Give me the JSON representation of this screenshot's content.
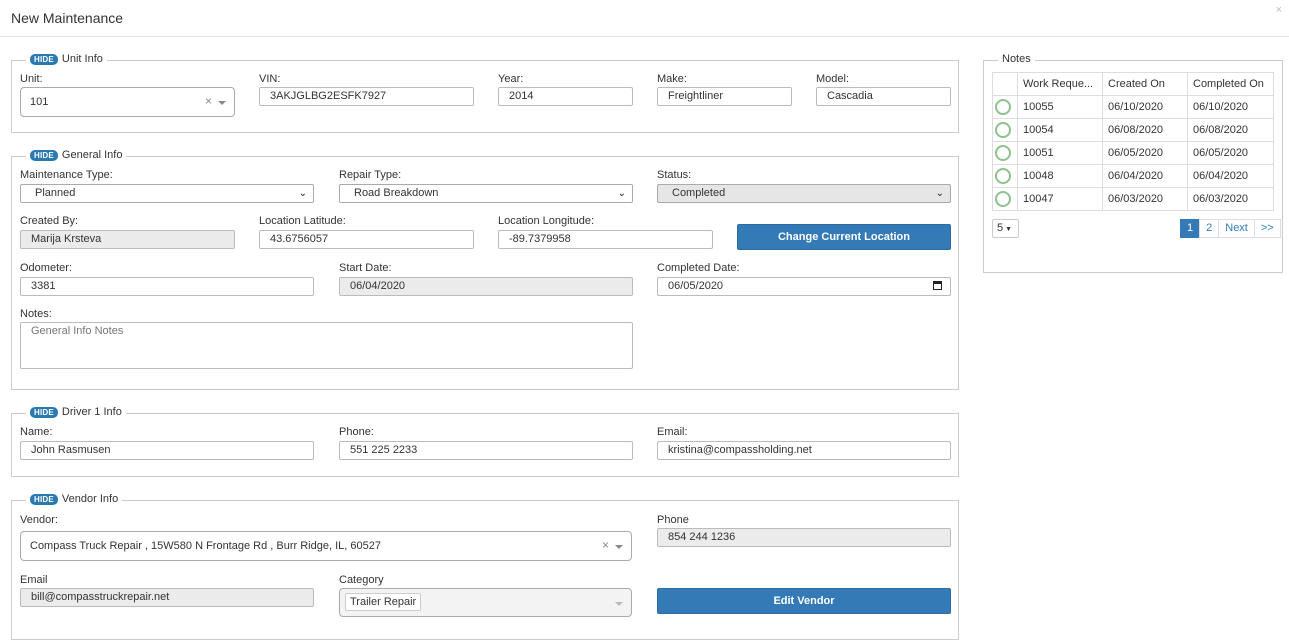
{
  "modal": {
    "title": "New Maintenance",
    "close": "×"
  },
  "unit_info": {
    "hide": "HIDE",
    "title": "Unit Info",
    "unit_label": "Unit:",
    "unit_value": "101",
    "vin_label": "VIN:",
    "vin_value": "3AKJGLBG2ESFK7927",
    "year_label": "Year:",
    "year_value": "2014",
    "make_label": "Make:",
    "make_value": "Freightliner",
    "model_label": "Model:",
    "model_value": "Cascadia"
  },
  "general_info": {
    "hide": "HIDE",
    "title": "General Info",
    "maint_type_label": "Maintenance Type:",
    "maint_type_value": "Planned",
    "repair_type_label": "Repair Type:",
    "repair_type_value": "Road Breakdown",
    "status_label": "Status:",
    "status_value": "Completed",
    "created_by_label": "Created By:",
    "created_by_value": "Marija Krsteva",
    "lat_label": "Location Latitude:",
    "lat_value": "43.6756057",
    "lon_label": "Location Longitude:",
    "lon_value": "-89.7379958",
    "change_location": "Change Current Location",
    "odometer_label": "Odometer:",
    "odometer_value": "3381",
    "start_label": "Start Date:",
    "start_value": "06/04/2020",
    "completed_label": "Completed Date:",
    "completed_value": "06/05/2020",
    "notes_label": "Notes:",
    "notes_placeholder": "General Info Notes"
  },
  "driver": {
    "hide": "HIDE",
    "title": "Driver 1 Info",
    "name_label": "Name:",
    "name_value": "John Rasmusen",
    "phone_label": "Phone:",
    "phone_value": "551 225 2233",
    "email_label": "Email:",
    "email_value": "kristina@compassholding.net"
  },
  "vendor": {
    "hide": "HIDE",
    "title": "Vendor Info",
    "vendor_label": "Vendor:",
    "vendor_value": "Compass Truck Repair , 15W580 N Frontage Rd , Burr Ridge, IL, 60527",
    "phone_label": "Phone",
    "phone_value": "854 244 1236",
    "email_label": "Email",
    "email_value": "bill@compasstruckrepair.net",
    "category_label": "Category",
    "category_value": "Trailer Repair",
    "edit": "Edit Vendor"
  },
  "notes_panel": {
    "title": "Notes",
    "columns": [
      "Work Reque...",
      "Created On",
      "Completed On"
    ],
    "rows": [
      {
        "id": "10055",
        "created": "06/10/2020",
        "completed": "06/10/2020"
      },
      {
        "id": "10054",
        "created": "06/08/2020",
        "completed": "06/08/2020"
      },
      {
        "id": "10051",
        "created": "06/05/2020",
        "completed": "06/05/2020"
      },
      {
        "id": "10048",
        "created": "06/04/2020",
        "completed": "06/04/2020"
      },
      {
        "id": "10047",
        "created": "06/03/2020",
        "completed": "06/03/2020"
      }
    ],
    "page_size": "5",
    "pages": [
      "1",
      "2"
    ],
    "next": "Next",
    "last": ">>"
  },
  "colors": {
    "accent": "#337ab7",
    "badge": "#2a7ab0",
    "status_ring": "#8fc18f"
  }
}
